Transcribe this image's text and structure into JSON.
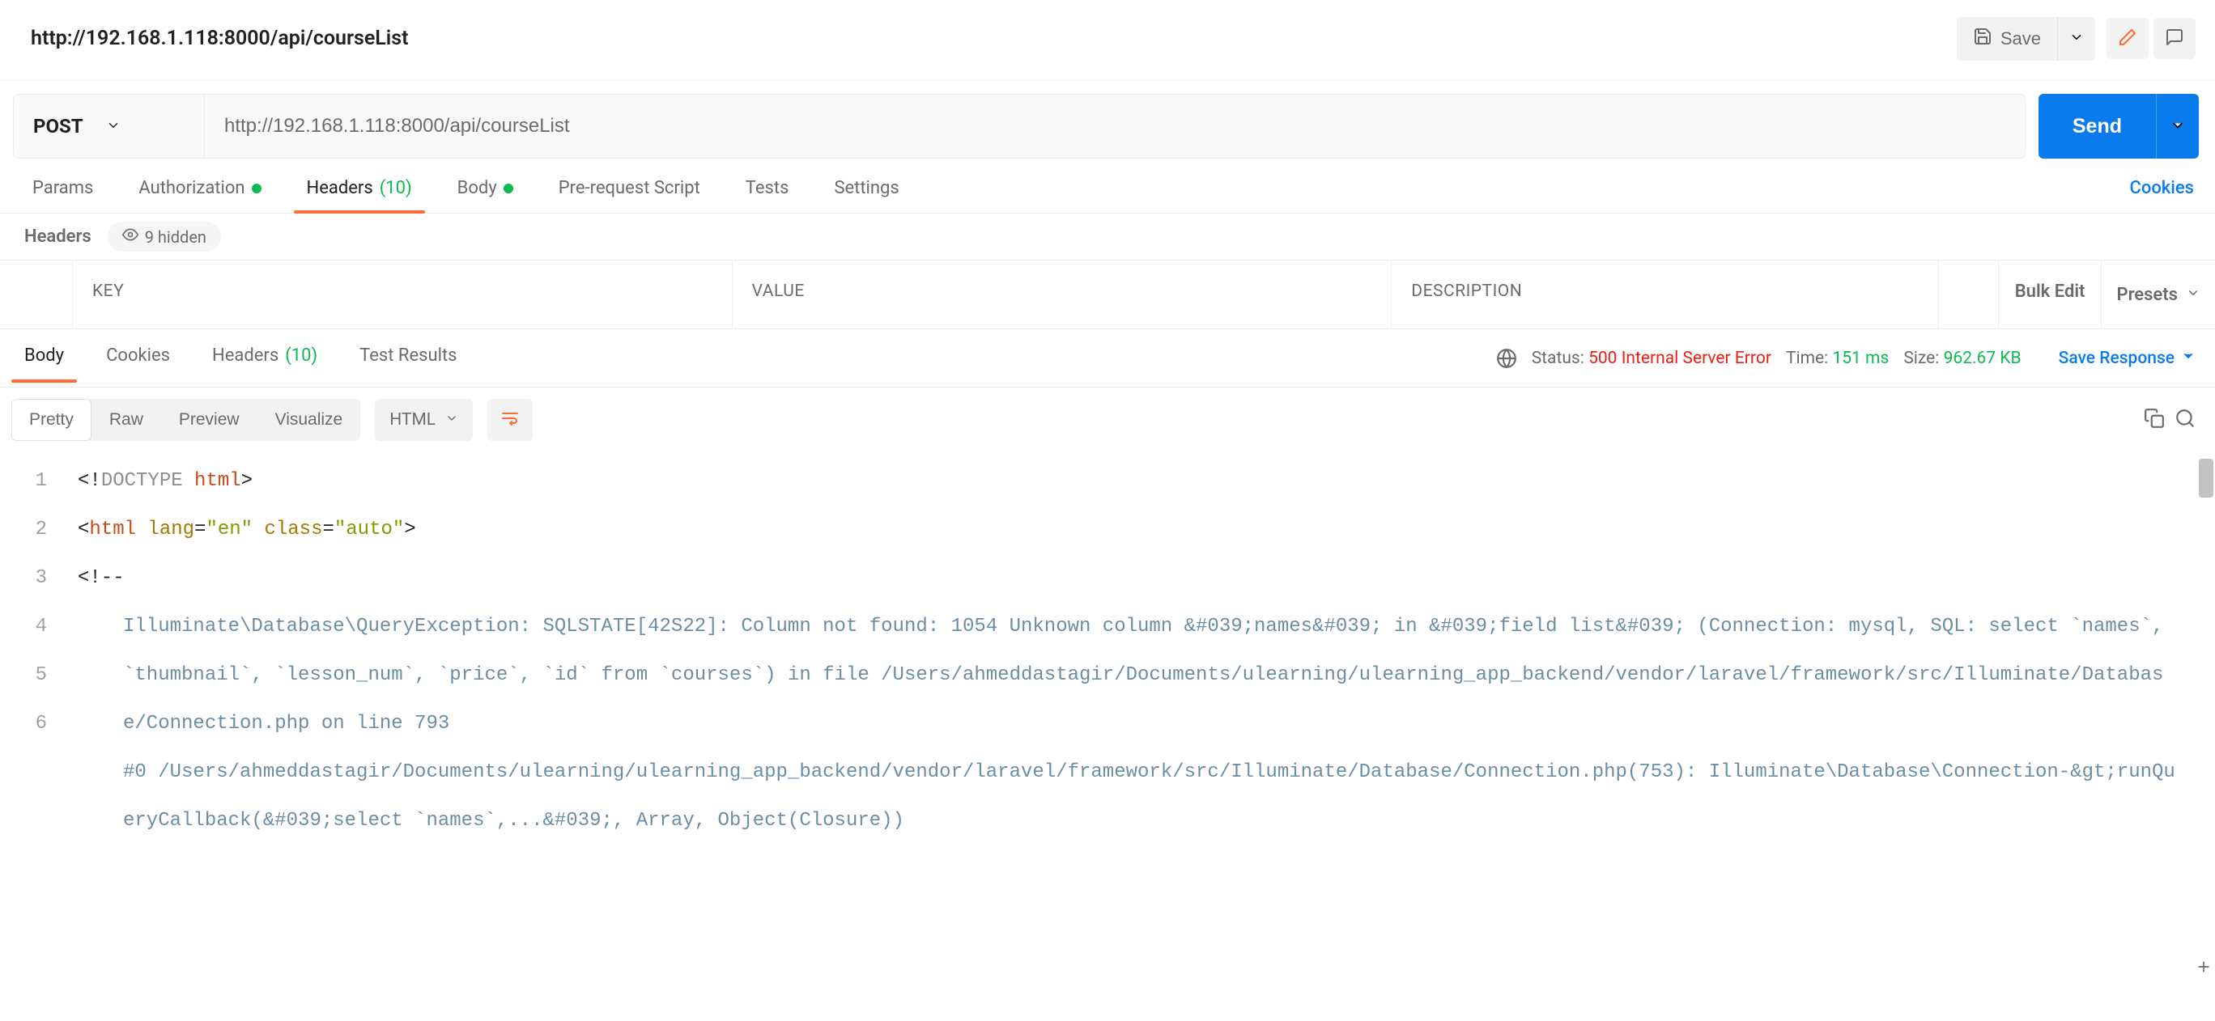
{
  "header": {
    "tab_title": "http://192.168.1.118:8000/api/courseList",
    "save_label": "Save"
  },
  "request": {
    "method": "POST",
    "url": "http://192.168.1.118:8000/api/courseList",
    "send_label": "Send",
    "tabs": {
      "params": "Params",
      "authorization": "Authorization",
      "headers": {
        "label": "Headers",
        "count": "(10)"
      },
      "body": "Body",
      "prerequest": "Pre-request Script",
      "tests": "Tests",
      "settings": "Settings"
    },
    "cookies_link": "Cookies",
    "headers_section": {
      "label": "Headers",
      "hidden_label": "9 hidden",
      "columns": {
        "key": "KEY",
        "value": "VALUE",
        "description": "DESCRIPTION"
      },
      "bulk_edit": "Bulk Edit",
      "presets": "Presets"
    }
  },
  "response": {
    "tabs": {
      "body": "Body",
      "cookies": "Cookies",
      "headers": {
        "label": "Headers",
        "count": "(10)"
      },
      "test_results": "Test Results"
    },
    "status": {
      "label": "Status:",
      "code": "500",
      "text": "Internal Server Error"
    },
    "time": {
      "label": "Time:",
      "value": "151 ms"
    },
    "size": {
      "label": "Size:",
      "value": "962.67 KB"
    },
    "save_response": "Save Response",
    "view": {
      "pretty": "Pretty",
      "raw": "Raw",
      "preview": "Preview",
      "visualize": "Visualize",
      "language": "HTML"
    },
    "code_lines": [
      "<!DOCTYPE html>",
      "<html lang=\"en\" class=\"auto\">",
      "<!--",
      "Illuminate\\Database\\QueryException: SQLSTATE[42S22]: Column not found: 1054 Unknown column &#039;names&#039; in &#039;field list&#039; (Connection: mysql, SQL: select `names`, `thumbnail`, `lesson_num`, `price`, `id` from `courses`) in file /Users/ahmeddastagir/Documents/ulearning/ulearning_app_backend/vendor/laravel/framework/src/Illuminate/Database/Connection.php on line 793",
      "",
      "#0 /Users/ahmeddastagir/Documents/ulearning/ulearning_app_backend/vendor/laravel/framework/src/Illuminate/Database/Connection.php(753): Illuminate\\Database\\Connection-&gt;runQueryCallback(&#039;select `names`,...&#039;, Array, Object(Closure))"
    ]
  }
}
